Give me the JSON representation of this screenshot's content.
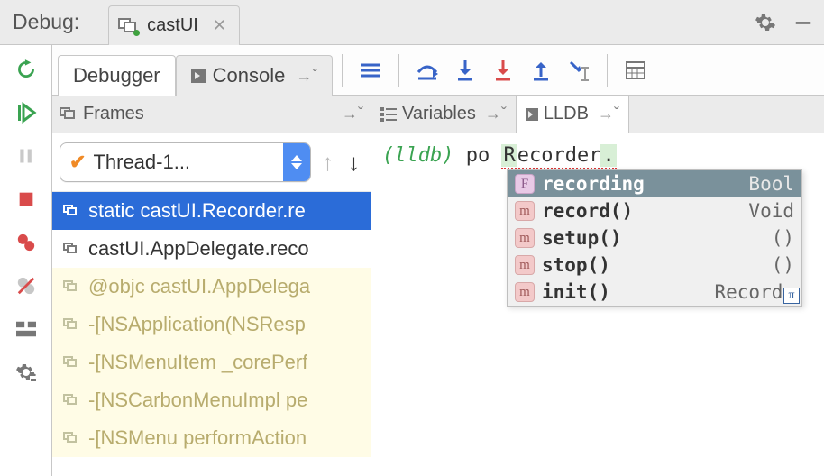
{
  "top": {
    "label": "Debug:",
    "tab": "castUI"
  },
  "tool_tabs": {
    "debugger": "Debugger",
    "console": "Console"
  },
  "frames_panel": {
    "title": "Frames",
    "thread": "Thread-1...",
    "frames": [
      {
        "label": "static castUI.Recorder.re",
        "state": "sel"
      },
      {
        "label": "castUI.AppDelegate.reco",
        "state": ""
      },
      {
        "label": "@objc castUI.AppDelega",
        "state": "dim"
      },
      {
        "label": "-[NSApplication(NSResp",
        "state": "dim"
      },
      {
        "label": "-[NSMenuItem _corePerf",
        "state": "dim"
      },
      {
        "label": "-[NSCarbonMenuImpl pe",
        "state": "dim"
      },
      {
        "label": "-[NSMenu performAction",
        "state": "dim"
      }
    ]
  },
  "sub_tabs": {
    "variables": "Variables",
    "lldb": "LLDB"
  },
  "console": {
    "prompt": "(lldb)",
    "cmd": "po",
    "obj_prefix": "R",
    "obj_mid": "ecorder",
    "obj_suffix": "."
  },
  "completions": [
    {
      "badge": "F",
      "name": "recording",
      "type": "Bool",
      "sel": true
    },
    {
      "badge": "m",
      "name": "record()",
      "type": "Void",
      "sel": false
    },
    {
      "badge": "m",
      "name": "setup()",
      "type": "()",
      "sel": false
    },
    {
      "badge": "m",
      "name": "stop()",
      "type": "()",
      "sel": false
    },
    {
      "badge": "m",
      "name": "init()",
      "type": "Recorde",
      "sel": false
    }
  ]
}
